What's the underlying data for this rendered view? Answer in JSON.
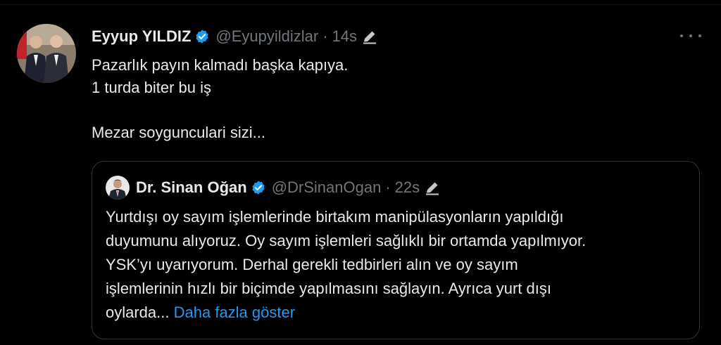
{
  "tweet": {
    "author_name": "Eyyup YILDIZ",
    "author_handle": "@Eyupyildizlar",
    "separator": "·",
    "time": "14s",
    "text_lines": [
      "Pazarlık payın kalmadı başka kapıya.",
      "1  turda biter bu iş",
      "",
      "Mezar soygunculari sizi..."
    ]
  },
  "quote": {
    "author_name": "Dr. Sinan Oğan",
    "author_handle": "@DrSinanOgan",
    "separator": "·",
    "time": "22s",
    "text_lines": [
      "Yurtdışı oy sayım işlemlerinde birtakım manipülasyonların yapıldığı",
      "duyumunu alıyoruz. Oy sayım işlemleri sağlıklı bir ortamda yapılmıyor.",
      "YSK’yı uyarıyorum. Derhal gerekli tedbirleri alın ve oy sayım",
      "işlemlerinin hızlı bir biçimde yapılmasını sağlayın. Ayrıca yurt dışı"
    ],
    "last_line_prefix": "oylarda... ",
    "show_more_label": "Daha fazla göster"
  },
  "icons": {
    "verified": "verified-badge-icon",
    "edit": "edit-pencil-icon",
    "more": "more-options-icon"
  },
  "colors": {
    "background": "#000000",
    "text": "#e7e9ea",
    "muted": "#71767b",
    "accent": "#1d9bf0",
    "border": "#2f3336"
  }
}
